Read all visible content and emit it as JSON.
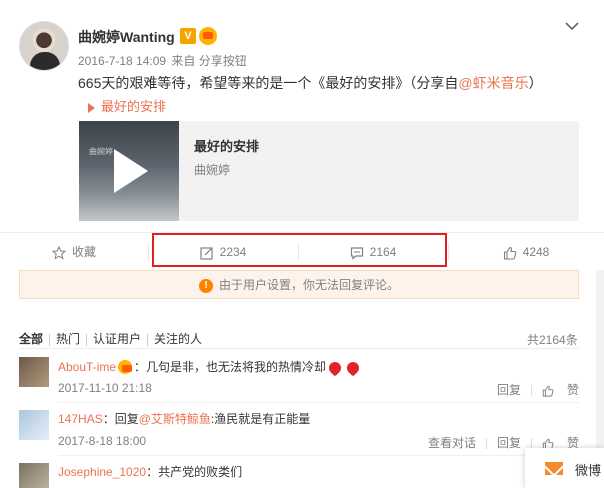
{
  "post": {
    "username": "曲婉婷Wanting",
    "verified_badge": "V",
    "timestamp": "2016-7-18 14:09",
    "source": "来自 分享按钮",
    "text": "665天的艰难等待，希望等来的是一个《最好的安排》（分享自",
    "mention": "@虾米音乐",
    "text_end": "）",
    "song_link": "最好的安排",
    "music_card": {
      "title": "最好的安排",
      "artist": "曲婉婷",
      "cover_text": "曲婉婷"
    }
  },
  "actions": {
    "favorite_label": "收藏",
    "repost_count": "2234",
    "comment_count": "2164",
    "like_count": "4248"
  },
  "notice": {
    "icon": "!",
    "text": "由于用户设置，你无法回复评论。"
  },
  "comments_header": {
    "tabs": [
      "全部",
      "热门",
      "认证用户",
      "关注的人"
    ],
    "total": "共2164条"
  },
  "comments": [
    {
      "name": "AbouT-ime",
      "text": "：几句是非，也无法将我的热情冷却",
      "time": "2017-11-10 21:18",
      "reply": "回复",
      "like": "赞"
    },
    {
      "name": "147HAS",
      "text_prefix": "：回复",
      "mention": "@艾斯特鲸鱼",
      "text": ":渔民就是有正能量",
      "time": "2017-8-18 18:00",
      "view_convo": "查看对话",
      "reply": "回复",
      "like": "赞"
    },
    {
      "name": "Josephine_1020",
      "text": "：共产党的败类们"
    }
  ],
  "floating": {
    "label": "微博"
  },
  "colors": {
    "accent": "#eb7350",
    "highlight_box": "#e02020",
    "notice_bg": "#fdf3eb"
  }
}
